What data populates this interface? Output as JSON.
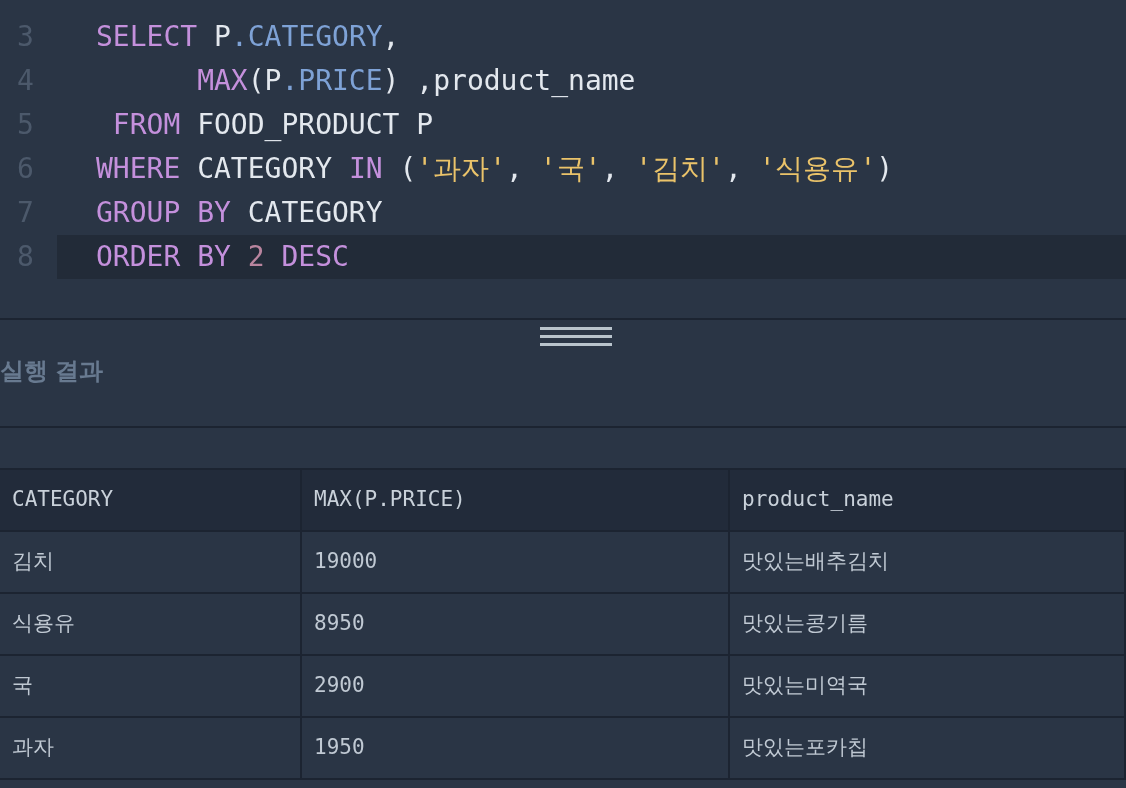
{
  "editor": {
    "lines": [
      {
        "number": "3",
        "current": false,
        "tokens": [
          {
            "kind": "keyword",
            "text": "SELECT"
          },
          {
            "kind": "plain",
            "text": " P"
          },
          {
            "kind": "property",
            "text": ".CATEGORY"
          },
          {
            "kind": "plain",
            "text": ","
          }
        ]
      },
      {
        "number": "4",
        "current": false,
        "tokens": [
          {
            "kind": "keyword",
            "text": "      MAX"
          },
          {
            "kind": "plain",
            "text": "(P"
          },
          {
            "kind": "property",
            "text": ".PRICE"
          },
          {
            "kind": "plain",
            "text": ") ,product_name"
          }
        ]
      },
      {
        "number": "5",
        "current": false,
        "tokens": [
          {
            "kind": "keyword",
            "text": " FROM"
          },
          {
            "kind": "plain",
            "text": " FOOD_PRODUCT P"
          }
        ]
      },
      {
        "number": "6",
        "current": false,
        "tokens": [
          {
            "kind": "keyword",
            "text": "WHERE"
          },
          {
            "kind": "plain",
            "text": " CATEGORY "
          },
          {
            "kind": "keyword",
            "text": "IN"
          },
          {
            "kind": "plain",
            "text": " ("
          },
          {
            "kind": "string",
            "text": "'과자'"
          },
          {
            "kind": "plain",
            "text": ", "
          },
          {
            "kind": "string",
            "text": "'국'"
          },
          {
            "kind": "plain",
            "text": ", "
          },
          {
            "kind": "string",
            "text": "'김치'"
          },
          {
            "kind": "plain",
            "text": ", "
          },
          {
            "kind": "string",
            "text": "'식용유'"
          },
          {
            "kind": "plain",
            "text": ")"
          }
        ]
      },
      {
        "number": "7",
        "current": false,
        "tokens": [
          {
            "kind": "keyword",
            "text": "GROUP BY"
          },
          {
            "kind": "plain",
            "text": " CATEGORY"
          }
        ]
      },
      {
        "number": "8",
        "current": true,
        "tokens": [
          {
            "kind": "keyword",
            "text": "ORDER BY"
          },
          {
            "kind": "number",
            "text": " 2"
          },
          {
            "kind": "keyword",
            "text": " DESC"
          }
        ]
      }
    ]
  },
  "results": {
    "title": "실행 결과",
    "table": {
      "columns": [
        "CATEGORY",
        "MAX(P.PRICE)",
        "product_name"
      ],
      "rows": [
        [
          "김치",
          "19000",
          "맛있는배추김치"
        ],
        [
          "식용유",
          "8950",
          "맛있는콩기름"
        ],
        [
          "국",
          "2900",
          "맛있는미역국"
        ],
        [
          "과자",
          "1950",
          "맛있는포카칩"
        ]
      ]
    }
  }
}
